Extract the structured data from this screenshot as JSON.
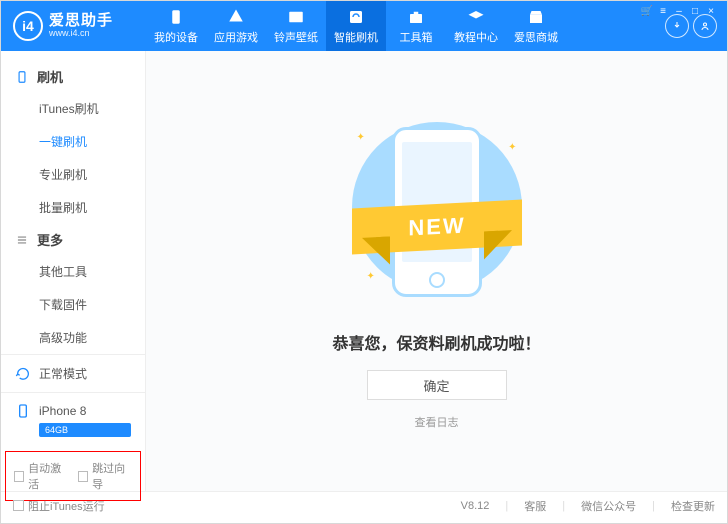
{
  "brand": {
    "cn": "爱思助手",
    "en": "www.i4.cn",
    "logo_text": "i4"
  },
  "nav": [
    {
      "key": "device",
      "label": "我的设备"
    },
    {
      "key": "apps",
      "label": "应用游戏"
    },
    {
      "key": "ring",
      "label": "铃声壁纸"
    },
    {
      "key": "flash",
      "label": "智能刷机",
      "active": true
    },
    {
      "key": "toolbox",
      "label": "工具箱"
    },
    {
      "key": "tutorial",
      "label": "教程中心"
    },
    {
      "key": "store",
      "label": "爱思商城"
    }
  ],
  "sidebar": {
    "sections": [
      {
        "title": "刷机",
        "items": [
          {
            "label": "iTunes刷机"
          },
          {
            "label": "一键刷机",
            "active": true
          },
          {
            "label": "专业刷机"
          },
          {
            "label": "批量刷机"
          }
        ]
      },
      {
        "title": "更多",
        "items": [
          {
            "label": "其他工具"
          },
          {
            "label": "下载固件"
          },
          {
            "label": "高级功能"
          }
        ]
      }
    ],
    "mode": "正常模式",
    "device": {
      "name": "iPhone 8",
      "storage": "64GB"
    },
    "checks": {
      "auto_activate": "自动激活",
      "skip_guide": "跳过向导"
    }
  },
  "main": {
    "ribbon": "NEW",
    "message": "恭喜您，保资料刷机成功啦！",
    "ok": "确定",
    "log": "查看日志"
  },
  "footer": {
    "block_itunes": "阻止iTunes运行",
    "version": "V8.12",
    "support": "客服",
    "wechat": "微信公众号",
    "update": "检查更新"
  }
}
